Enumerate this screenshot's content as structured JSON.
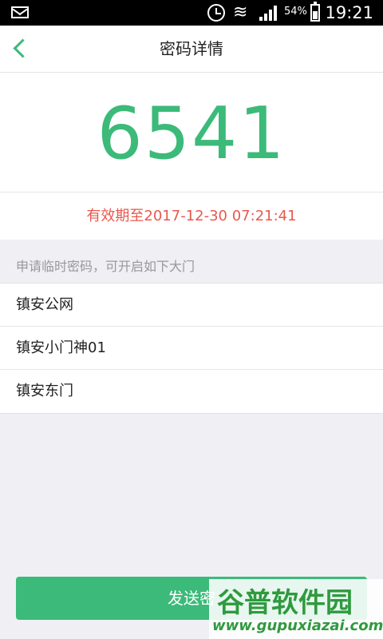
{
  "status_bar": {
    "battery_percent": "54%",
    "time": "19:21"
  },
  "nav": {
    "title": "密码详情"
  },
  "password": {
    "code": "6541",
    "validity": "有效期至2017-12-30 07:21:41"
  },
  "doors": {
    "section_label": "申请临时密码，可开启如下大门",
    "items": [
      "镇安公网",
      "镇安小门神01",
      "镇安东门"
    ]
  },
  "actions": {
    "send_label": "发送密"
  },
  "watermark": {
    "logo_text": "谷普软件园",
    "url": "www.gupuxiazai.com"
  },
  "colors": {
    "accent": "#3cba79",
    "validity": "#e9584e"
  }
}
